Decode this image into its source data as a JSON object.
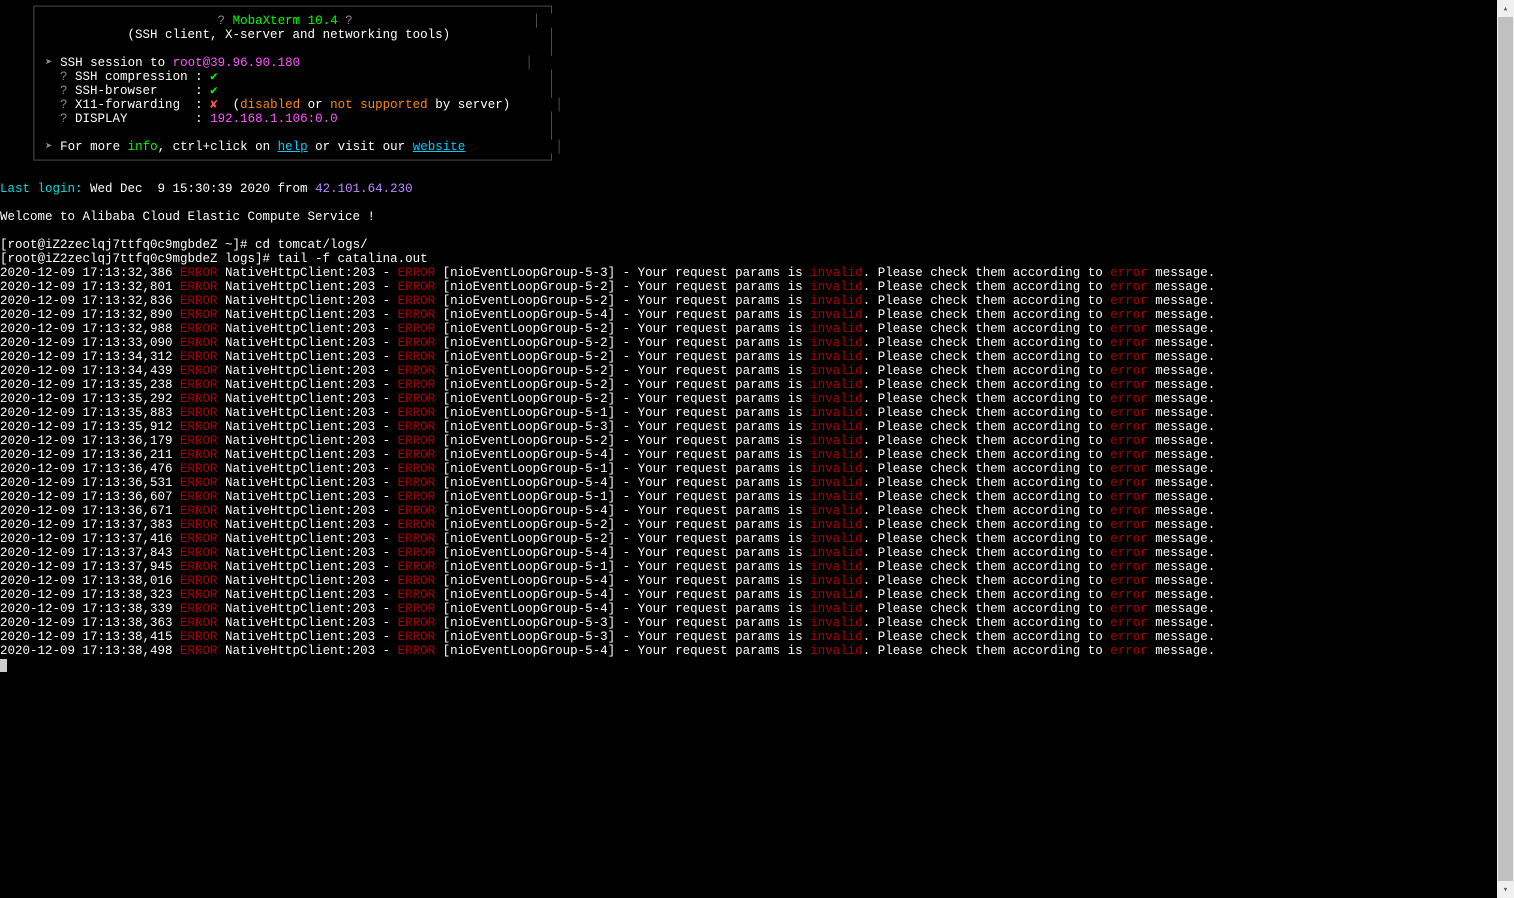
{
  "banner": {
    "title_prefix": "?",
    "title": "MobaXterm 10.4",
    "title_suffix": "?",
    "subtitle": "(SSH client, X-server and networking tools)",
    "session_arrow": "➤",
    "session_label": "SSH session to",
    "session_user": "root",
    "session_at": "@",
    "session_host": "39.96.90.180",
    "feat_comp_q": "?",
    "feat_comp_label": "SSH compression :",
    "feat_comp_val": "✔",
    "feat_browser_q": "?",
    "feat_browser_label": "SSH-browser     :",
    "feat_browser_val": "✔",
    "feat_x11_q": "?",
    "feat_x11_label": "X11-forwarding  :",
    "feat_x11_val": "✘",
    "feat_x11_note_open": "  (",
    "feat_x11_disabled": "disabled",
    "feat_x11_or": " or ",
    "feat_x11_notsup": "not supported",
    "feat_x11_byserver": " by server)",
    "feat_disp_q": "?",
    "feat_disp_label": "DISPLAY         :",
    "feat_disp_val": "192.168.1.106:0.0",
    "info_arrow": "➤",
    "info_for_more": "For more",
    "info_info": "info",
    "info_ctrl": ", ctrl+click on",
    "info_help": "help",
    "info_or": " or visit our",
    "info_website": "website"
  },
  "session": {
    "last_login_label": "Last login:",
    "last_login_text": " Wed Dec  9 15:30:39 2020 from ",
    "last_login_ip": "42.101.64.230",
    "welcome": "Welcome to Alibaba Cloud Elastic Compute Service !",
    "prompt1_user": "[root@iZ2zeclqj7ttfq0c9mgbdeZ ~]#",
    "prompt1_cmd": " cd tomcat/logs/",
    "prompt2_user": "[root@iZ2zeclqj7ttfq0c9mgbdeZ logs]#",
    "prompt2_cmd": " tail -f catalina.out"
  },
  "log_template": {
    "err1": "ERROR",
    "src": " NativeHttpClient:203 - ",
    "err2": "ERROR",
    "mid1": " - Your request params is ",
    "invalid": "invalid",
    "mid2": ". Please check them according to ",
    "err3": "error",
    "tail": " message."
  },
  "logs": [
    {
      "ts": "2020-12-09 17:13:32,386",
      "thread": "[nioEventLoopGroup-5-3]"
    },
    {
      "ts": "2020-12-09 17:13:32,801",
      "thread": "[nioEventLoopGroup-5-2]"
    },
    {
      "ts": "2020-12-09 17:13:32,836",
      "thread": "[nioEventLoopGroup-5-2]"
    },
    {
      "ts": "2020-12-09 17:13:32,890",
      "thread": "[nioEventLoopGroup-5-4]"
    },
    {
      "ts": "2020-12-09 17:13:32,988",
      "thread": "[nioEventLoopGroup-5-2]"
    },
    {
      "ts": "2020-12-09 17:13:33,090",
      "thread": "[nioEventLoopGroup-5-2]"
    },
    {
      "ts": "2020-12-09 17:13:34,312",
      "thread": "[nioEventLoopGroup-5-2]"
    },
    {
      "ts": "2020-12-09 17:13:34,439",
      "thread": "[nioEventLoopGroup-5-2]"
    },
    {
      "ts": "2020-12-09 17:13:35,238",
      "thread": "[nioEventLoopGroup-5-2]"
    },
    {
      "ts": "2020-12-09 17:13:35,292",
      "thread": "[nioEventLoopGroup-5-2]"
    },
    {
      "ts": "2020-12-09 17:13:35,883",
      "thread": "[nioEventLoopGroup-5-1]"
    },
    {
      "ts": "2020-12-09 17:13:35,912",
      "thread": "[nioEventLoopGroup-5-3]"
    },
    {
      "ts": "2020-12-09 17:13:36,179",
      "thread": "[nioEventLoopGroup-5-2]"
    },
    {
      "ts": "2020-12-09 17:13:36,211",
      "thread": "[nioEventLoopGroup-5-4]"
    },
    {
      "ts": "2020-12-09 17:13:36,476",
      "thread": "[nioEventLoopGroup-5-1]"
    },
    {
      "ts": "2020-12-09 17:13:36,531",
      "thread": "[nioEventLoopGroup-5-4]"
    },
    {
      "ts": "2020-12-09 17:13:36,607",
      "thread": "[nioEventLoopGroup-5-1]"
    },
    {
      "ts": "2020-12-09 17:13:36,671",
      "thread": "[nioEventLoopGroup-5-4]"
    },
    {
      "ts": "2020-12-09 17:13:37,383",
      "thread": "[nioEventLoopGroup-5-2]"
    },
    {
      "ts": "2020-12-09 17:13:37,416",
      "thread": "[nioEventLoopGroup-5-2]"
    },
    {
      "ts": "2020-12-09 17:13:37,843",
      "thread": "[nioEventLoopGroup-5-4]"
    },
    {
      "ts": "2020-12-09 17:13:37,945",
      "thread": "[nioEventLoopGroup-5-1]"
    },
    {
      "ts": "2020-12-09 17:13:38,016",
      "thread": "[nioEventLoopGroup-5-4]"
    },
    {
      "ts": "2020-12-09 17:13:38,323",
      "thread": "[nioEventLoopGroup-5-4]"
    },
    {
      "ts": "2020-12-09 17:13:38,339",
      "thread": "[nioEventLoopGroup-5-4]"
    },
    {
      "ts": "2020-12-09 17:13:38,363",
      "thread": "[nioEventLoopGroup-5-3]"
    },
    {
      "ts": "2020-12-09 17:13:38,415",
      "thread": "[nioEventLoopGroup-5-3]"
    },
    {
      "ts": "2020-12-09 17:13:38,498",
      "thread": "[nioEventLoopGroup-5-4]"
    }
  ]
}
